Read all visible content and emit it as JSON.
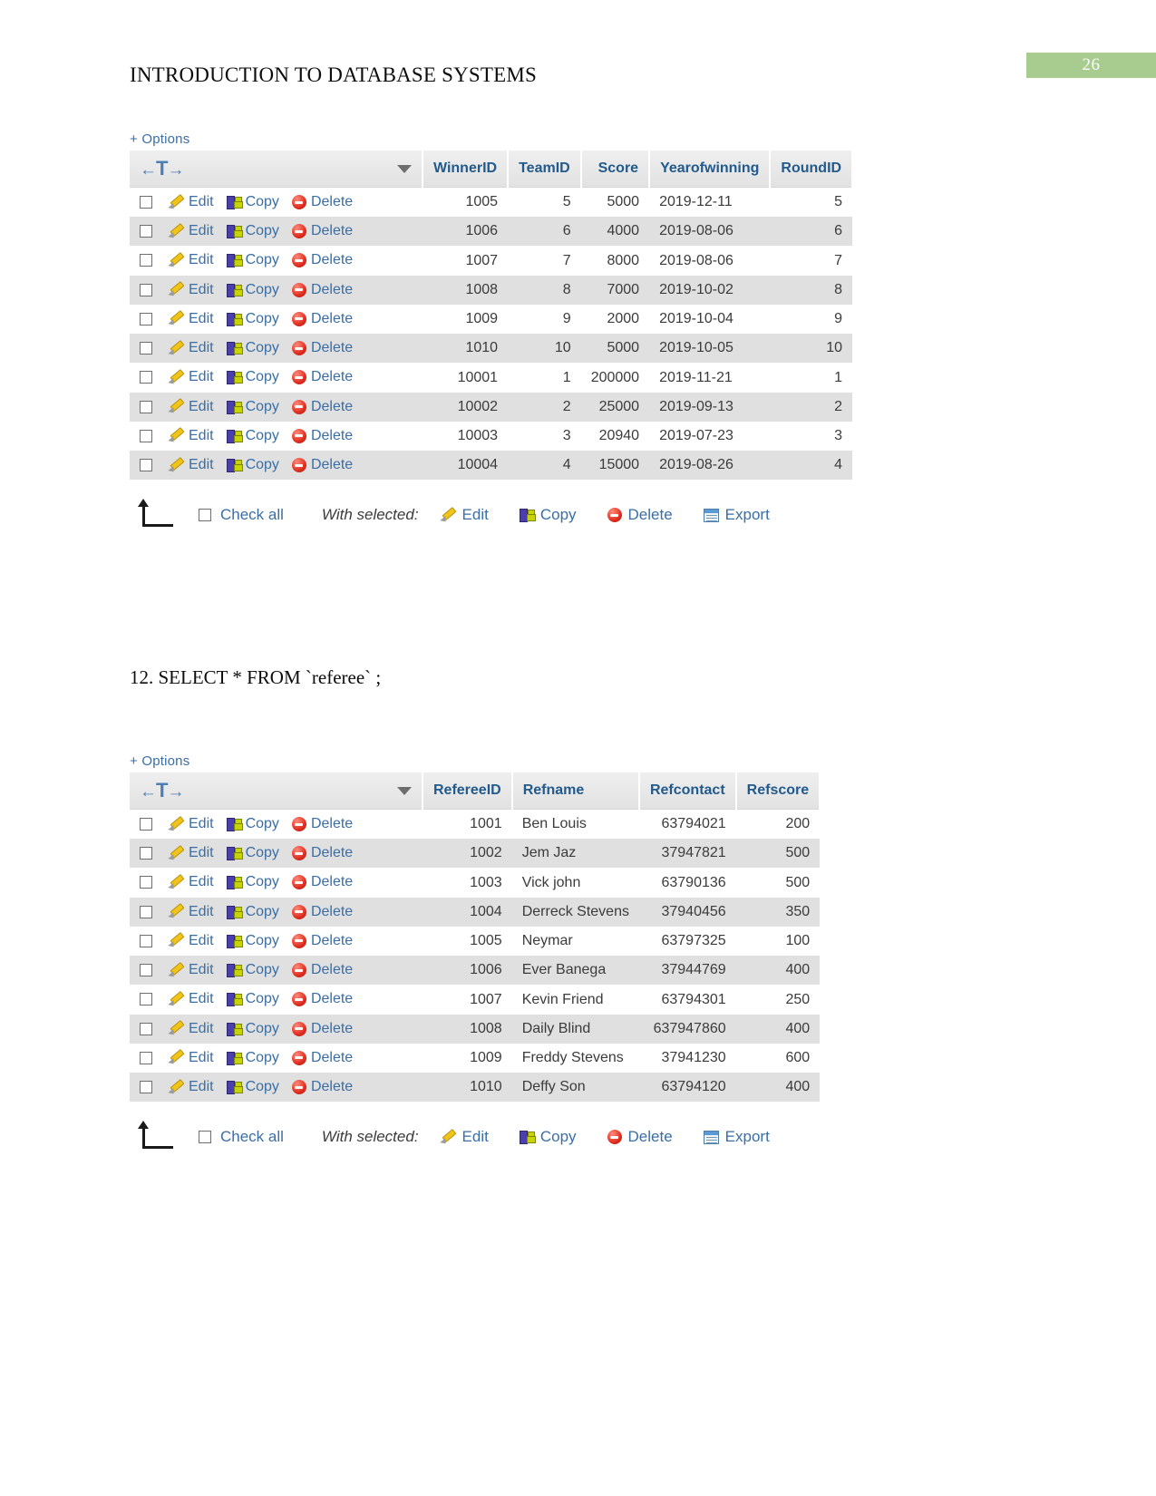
{
  "page": {
    "header_title": "INTRODUCTION TO DATABASE SYSTEMS",
    "page_number": "26",
    "banner_color": "#a8cb8f",
    "sql_caption": "12. SELECT * FROM `referee` ;"
  },
  "common": {
    "options_label": "+ Options",
    "nav_left": "←",
    "nav_t": "T",
    "nav_right": "→",
    "row_actions": {
      "edit": "Edit",
      "copy": "Copy",
      "delete": "Delete"
    },
    "footer": {
      "check_all": "Check all",
      "with_selected": "With selected:",
      "edit": "Edit",
      "copy": "Copy",
      "delete": "Delete",
      "export": "Export"
    }
  },
  "winner_table": {
    "columns": [
      {
        "label": "WinnerID",
        "align": "num"
      },
      {
        "label": "TeamID",
        "align": "num"
      },
      {
        "label": "Score",
        "align": "num"
      },
      {
        "label": "Yearofwinning",
        "align": "txt"
      },
      {
        "label": "RoundID",
        "align": "num"
      }
    ],
    "rows": [
      {
        "WinnerID": "1005",
        "TeamID": "5",
        "Score": "5000",
        "Yearofwinning": "2019-12-11",
        "RoundID": "5"
      },
      {
        "WinnerID": "1006",
        "TeamID": "6",
        "Score": "4000",
        "Yearofwinning": "2019-08-06",
        "RoundID": "6"
      },
      {
        "WinnerID": "1007",
        "TeamID": "7",
        "Score": "8000",
        "Yearofwinning": "2019-08-06",
        "RoundID": "7"
      },
      {
        "WinnerID": "1008",
        "TeamID": "8",
        "Score": "7000",
        "Yearofwinning": "2019-10-02",
        "RoundID": "8"
      },
      {
        "WinnerID": "1009",
        "TeamID": "9",
        "Score": "2000",
        "Yearofwinning": "2019-10-04",
        "RoundID": "9"
      },
      {
        "WinnerID": "1010",
        "TeamID": "10",
        "Score": "5000",
        "Yearofwinning": "2019-10-05",
        "RoundID": "10"
      },
      {
        "WinnerID": "10001",
        "TeamID": "1",
        "Score": "200000",
        "Yearofwinning": "2019-11-21",
        "RoundID": "1"
      },
      {
        "WinnerID": "10002",
        "TeamID": "2",
        "Score": "25000",
        "Yearofwinning": "2019-09-13",
        "RoundID": "2"
      },
      {
        "WinnerID": "10003",
        "TeamID": "3",
        "Score": "20940",
        "Yearofwinning": "2019-07-23",
        "RoundID": "3"
      },
      {
        "WinnerID": "10004",
        "TeamID": "4",
        "Score": "15000",
        "Yearofwinning": "2019-08-26",
        "RoundID": "4"
      }
    ]
  },
  "referee_table": {
    "columns": [
      {
        "label": "RefereeID",
        "align": "num"
      },
      {
        "label": "Refname",
        "align": "txt"
      },
      {
        "label": "Refcontact",
        "align": "num"
      },
      {
        "label": "Refscore",
        "align": "num"
      }
    ],
    "rows": [
      {
        "RefereeID": "1001",
        "Refname": "Ben Louis",
        "Refcontact": "63794021",
        "Refscore": "200"
      },
      {
        "RefereeID": "1002",
        "Refname": "Jem Jaz",
        "Refcontact": "37947821",
        "Refscore": "500"
      },
      {
        "RefereeID": "1003",
        "Refname": "Vick john",
        "Refcontact": "63790136",
        "Refscore": "500"
      },
      {
        "RefereeID": "1004",
        "Refname": "Derreck Stevens",
        "Refcontact": "37940456",
        "Refscore": "350"
      },
      {
        "RefereeID": "1005",
        "Refname": "Neymar",
        "Refcontact": "63797325",
        "Refscore": "100"
      },
      {
        "RefereeID": "1006",
        "Refname": "Ever Banega",
        "Refcontact": "37944769",
        "Refscore": "400"
      },
      {
        "RefereeID": "1007",
        "Refname": "Kevin Friend",
        "Refcontact": "63794301",
        "Refscore": "250"
      },
      {
        "RefereeID": "1008",
        "Refname": "Daily Blind",
        "Refcontact": "637947860",
        "Refscore": "400"
      },
      {
        "RefereeID": "1009",
        "Refname": "Freddy Stevens",
        "Refcontact": "37941230",
        "Refscore": "600"
      },
      {
        "RefereeID": "1010",
        "Refname": "Deffy Son",
        "Refcontact": "63794120",
        "Refscore": "400"
      }
    ]
  }
}
